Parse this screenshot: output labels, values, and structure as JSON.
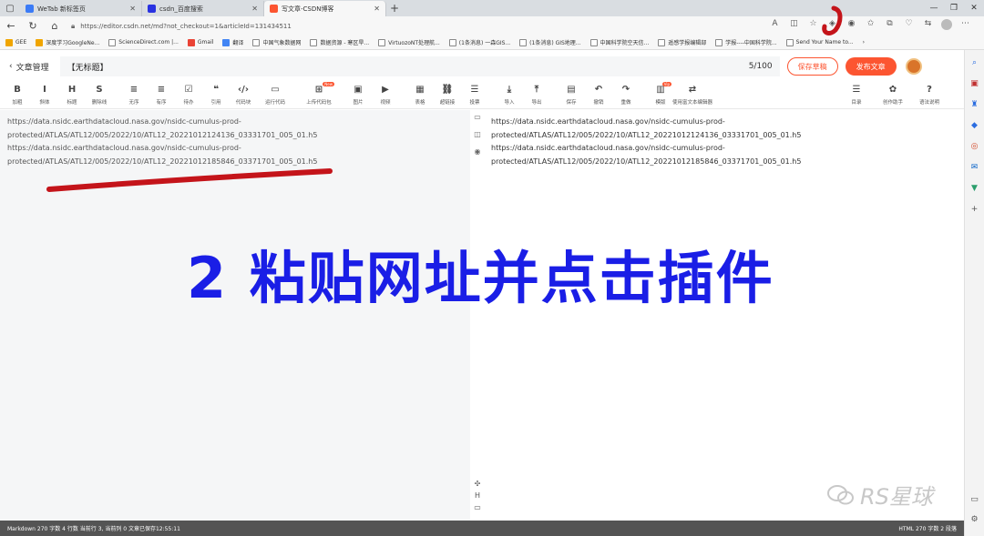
{
  "browser": {
    "tabs": [
      {
        "label": "WeTab 新标签页",
        "color": "#3b7bf6"
      },
      {
        "label": "csdn_百度搜索",
        "color": "#2932e1"
      },
      {
        "label": "写文章-CSDN博客",
        "color": "#fc5531"
      }
    ],
    "url": "https://editor.csdn.net/md?not_checkout=1&articleId=131434511",
    "bookmarks": [
      "GEE",
      "深度学习GoogleNe...",
      "ScienceDirect.com |...",
      "Gmail",
      "翻译",
      "中国气象数据网",
      "数据资源 - 寒区旱...",
      "VirtuozoNT处理航...",
      "(1条消息) 一森GIS...",
      "(1条消息) GIS地理...",
      "中国科学院空天信...",
      "遥感学报编辑部",
      "学报----中国科学院...",
      "Send Your Name to..."
    ]
  },
  "editor": {
    "back_label": "文章管理",
    "title": "【无标题】",
    "title_count": "5/100",
    "save_draft_label": "保存草稿",
    "publish_label": "发布文章"
  },
  "toolbar": {
    "tools": [
      {
        "glyph": "B",
        "label": "加粗"
      },
      {
        "glyph": "I",
        "label": "斜体"
      },
      {
        "glyph": "H",
        "label": "标题"
      },
      {
        "glyph": "S",
        "label": "删除线"
      },
      {
        "glyph": "≡",
        "label": "无序"
      },
      {
        "glyph": "≡",
        "label": "有序"
      },
      {
        "glyph": "☑",
        "label": "待办"
      },
      {
        "glyph": "❝",
        "label": "引用"
      },
      {
        "glyph": "‹/›",
        "label": "代码块"
      },
      {
        "glyph": "▭",
        "label": "运行代码"
      },
      {
        "glyph": "⊞",
        "label": "上传代码包",
        "badge": "New"
      },
      {
        "glyph": "▣",
        "label": "图片"
      },
      {
        "glyph": "▶",
        "label": "视频"
      },
      {
        "glyph": "▦",
        "label": "表格"
      },
      {
        "glyph": "⛓",
        "label": "超链接"
      },
      {
        "glyph": "☰",
        "label": "投票"
      },
      {
        "glyph": "⤓",
        "label": "导入"
      },
      {
        "glyph": "⤒",
        "label": "导出"
      },
      {
        "glyph": "▤",
        "label": "保存"
      },
      {
        "glyph": "↶",
        "label": "撤销"
      },
      {
        "glyph": "↷",
        "label": "重做"
      },
      {
        "glyph": "▥",
        "label": "模版",
        "badge": "Vip"
      },
      {
        "glyph": "⇄",
        "label": "使用富文本编辑器"
      }
    ],
    "right_tools": [
      {
        "glyph": "☰",
        "label": "目录"
      },
      {
        "glyph": "✿",
        "label": "创作助手"
      },
      {
        "glyph": "?",
        "label": "语法说明"
      }
    ]
  },
  "content": {
    "lines": [
      "https://data.nsidc.earthdatacloud.nasa.gov/nsidc-cumulus-prod-",
      "protected/ATLAS/ATL12/005/2022/10/ATL12_20221012124136_03331701_005_01.h5",
      "https://data.nsidc.earthdatacloud.nasa.gov/nsidc-cumulus-prod-",
      "protected/ATLAS/ATL12/005/2022/10/ATL12_20221012185846_03371701_005_01.h5"
    ]
  },
  "annotation": {
    "caption": "2 粘贴网址并点击插件",
    "caption_color": "#1a1ee6",
    "mark_color": "#c4141a"
  },
  "watermark": {
    "text": "RS星球"
  },
  "statusbar": {
    "left": "Markdown  270 字数  4 行数  当前行 3, 当前列 0  文章已保存12:55:11",
    "right": "HTML  270 字数  2 段落"
  },
  "colors": {
    "accent": "#fc5531",
    "status_bg": "#545454"
  }
}
